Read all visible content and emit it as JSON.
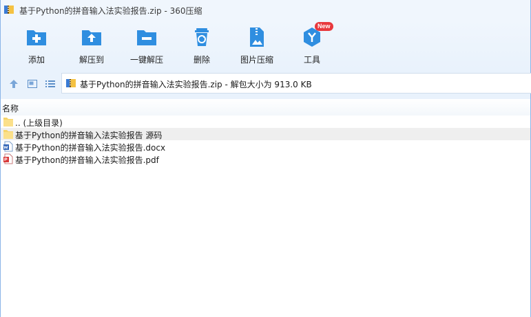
{
  "window": {
    "title": "基于Python的拼音输入法实验报告.zip - 360压缩"
  },
  "toolbar": {
    "items": [
      {
        "label": "添加",
        "icon": "add-icon"
      },
      {
        "label": "解压到",
        "icon": "extract-to-icon"
      },
      {
        "label": "一键解压",
        "icon": "one-click-extract-icon"
      },
      {
        "label": "删除",
        "icon": "delete-icon"
      },
      {
        "label": "图片压缩",
        "icon": "image-compress-icon"
      },
      {
        "label": "工具",
        "icon": "tools-icon",
        "badge": "New"
      }
    ]
  },
  "address": {
    "text": "基于Python的拼音输入法实验报告.zip - 解包大小为 913.0 KB"
  },
  "list": {
    "column_name": "名称",
    "rows": [
      {
        "name": ".. (上级目录)",
        "type": "parent-folder"
      },
      {
        "name": "基于Python的拼音输入法实验报告 源码",
        "type": "folder"
      },
      {
        "name": "基于Python的拼音输入法实验报告.docx",
        "type": "docx"
      },
      {
        "name": "基于Python的拼音输入法实验报告.pdf",
        "type": "pdf"
      }
    ]
  },
  "colors": {
    "accent": "#2f8ee0",
    "toolbar_bg": "#e9f2fc",
    "badge": "#e8383d",
    "folder": "#f6d46a"
  }
}
